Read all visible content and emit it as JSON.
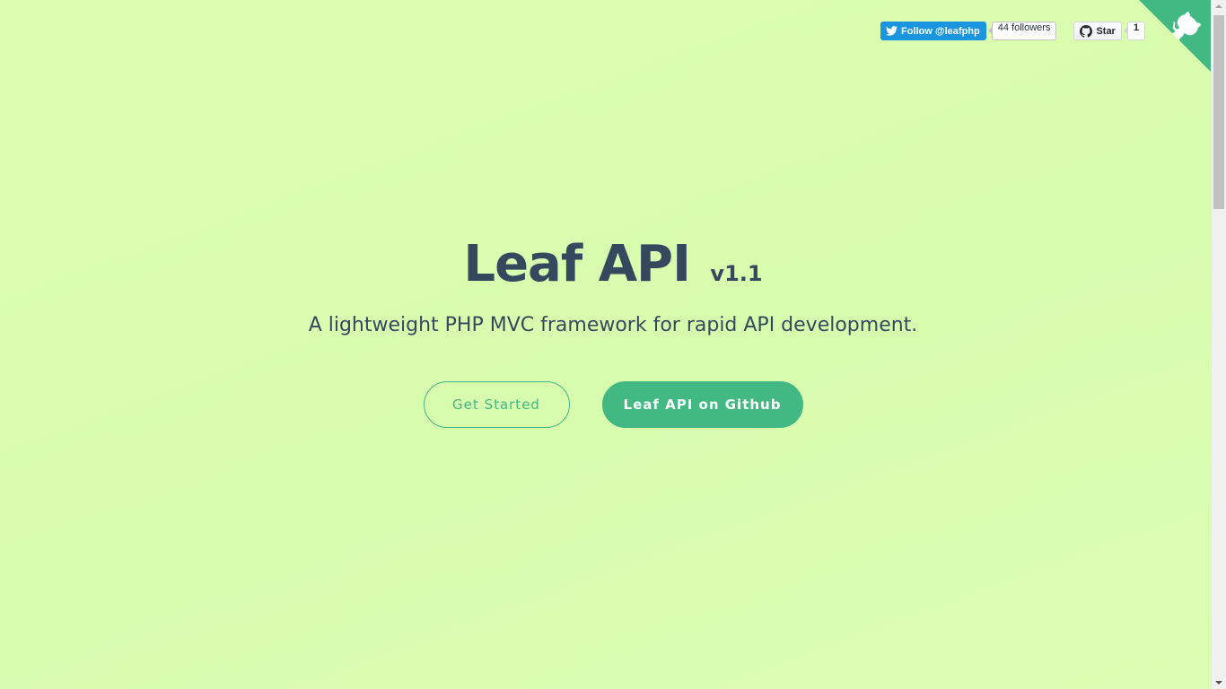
{
  "social": {
    "twitter_follow_label": "Follow @leafphp",
    "twitter_followers": "44 followers",
    "github_star_label": "Star",
    "github_star_count": "1"
  },
  "hero": {
    "title": "Leaf API",
    "version": "v1.1",
    "subtitle": "A lightweight PHP MVC framework for rapid API development.",
    "get_started_label": "Get Started",
    "github_button_label": "Leaf API on Github"
  },
  "colors": {
    "background": "#dcffb0",
    "accent": "#42b983",
    "text": "#34495e",
    "twitter": "#1b95e0"
  },
  "icons": {
    "twitter": "twitter-bird-icon",
    "github": "github-mark-icon",
    "corner": "github-octocat-corner-icon"
  }
}
